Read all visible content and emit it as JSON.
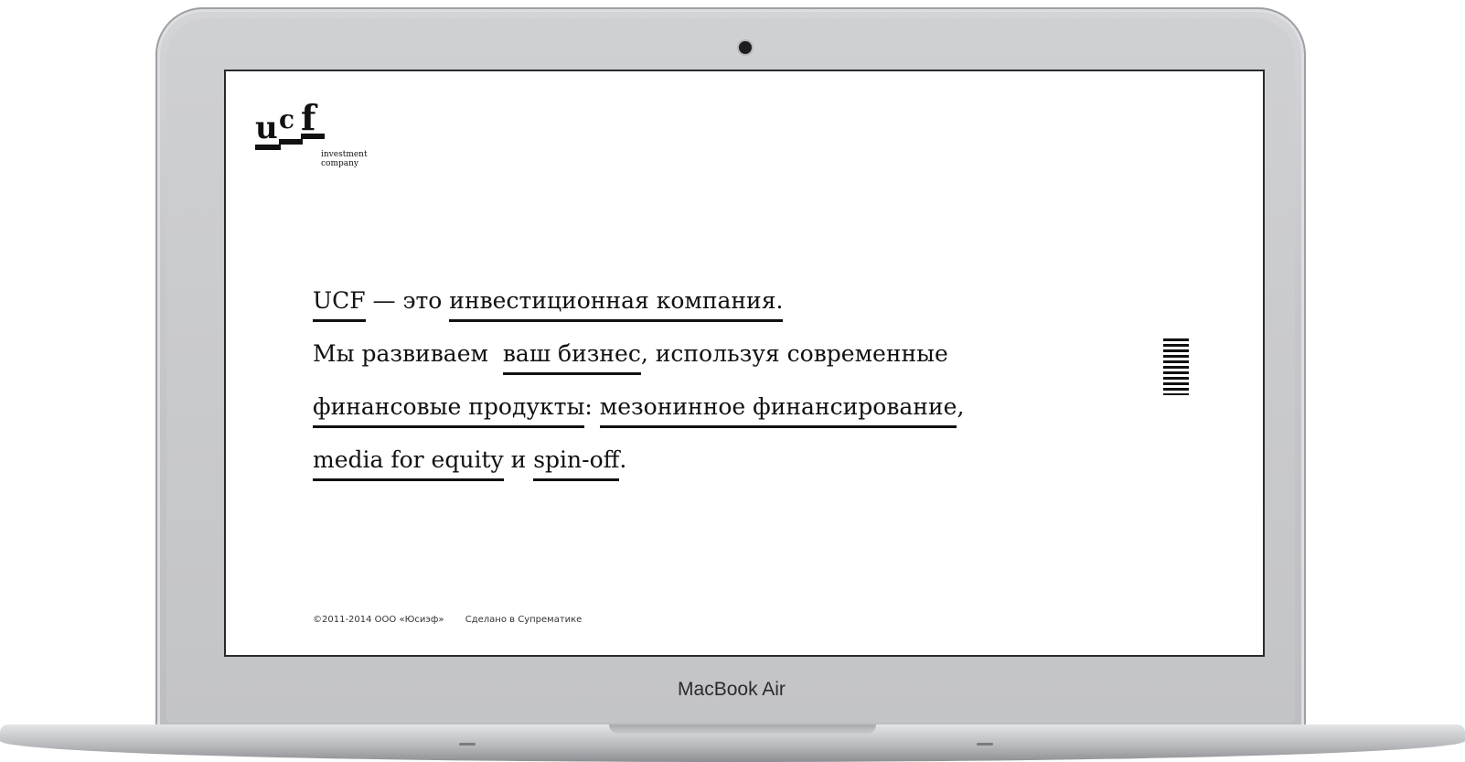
{
  "device": {
    "label": "MacBook Air"
  },
  "logo": {
    "letters": [
      "u",
      "c",
      "f"
    ],
    "line1": "investment",
    "line2": "company"
  },
  "hero": {
    "line1": {
      "a": "UCF",
      "b": " — это ",
      "c": "инвестиционная компания."
    },
    "line2": {
      "a": "Мы развиваем ",
      "b": "ваш бизнес",
      "c": ", используя современные"
    },
    "line3": {
      "a": "финансовые продукты",
      "b": ": ",
      "c": "мезонинное финансирование",
      "d": ","
    },
    "line4": {
      "a": "media for equity",
      "b": " и ",
      "c": "spin-off",
      "d": "."
    }
  },
  "menu": {
    "icon": "menu-lines-icon"
  },
  "footer": {
    "copyright": "©2011-2014 ООО «Юсиэф»",
    "credit": "Сделано в Супрематике"
  },
  "colors": {
    "text": "#111111",
    "screen_bg": "#ffffff"
  }
}
